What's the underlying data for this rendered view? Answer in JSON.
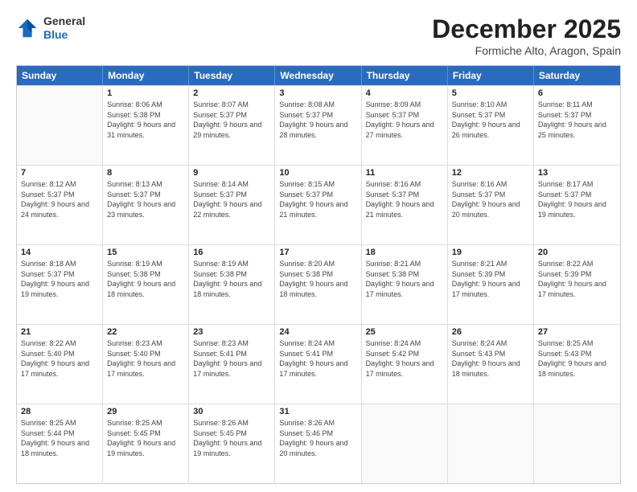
{
  "logo": {
    "general": "General",
    "blue": "Blue"
  },
  "header": {
    "title": "December 2025",
    "subtitle": "Formiche Alto, Aragon, Spain"
  },
  "days": [
    "Sunday",
    "Monday",
    "Tuesday",
    "Wednesday",
    "Thursday",
    "Friday",
    "Saturday"
  ],
  "weeks": [
    [
      {
        "day": "",
        "sunrise": "",
        "sunset": "",
        "daylight": ""
      },
      {
        "day": "1",
        "sunrise": "Sunrise: 8:06 AM",
        "sunset": "Sunset: 5:38 PM",
        "daylight": "Daylight: 9 hours and 31 minutes."
      },
      {
        "day": "2",
        "sunrise": "Sunrise: 8:07 AM",
        "sunset": "Sunset: 5:37 PM",
        "daylight": "Daylight: 9 hours and 29 minutes."
      },
      {
        "day": "3",
        "sunrise": "Sunrise: 8:08 AM",
        "sunset": "Sunset: 5:37 PM",
        "daylight": "Daylight: 9 hours and 28 minutes."
      },
      {
        "day": "4",
        "sunrise": "Sunrise: 8:09 AM",
        "sunset": "Sunset: 5:37 PM",
        "daylight": "Daylight: 9 hours and 27 minutes."
      },
      {
        "day": "5",
        "sunrise": "Sunrise: 8:10 AM",
        "sunset": "Sunset: 5:37 PM",
        "daylight": "Daylight: 9 hours and 26 minutes."
      },
      {
        "day": "6",
        "sunrise": "Sunrise: 8:11 AM",
        "sunset": "Sunset: 5:37 PM",
        "daylight": "Daylight: 9 hours and 25 minutes."
      }
    ],
    [
      {
        "day": "7",
        "sunrise": "Sunrise: 8:12 AM",
        "sunset": "Sunset: 5:37 PM",
        "daylight": "Daylight: 9 hours and 24 minutes."
      },
      {
        "day": "8",
        "sunrise": "Sunrise: 8:13 AM",
        "sunset": "Sunset: 5:37 PM",
        "daylight": "Daylight: 9 hours and 23 minutes."
      },
      {
        "day": "9",
        "sunrise": "Sunrise: 8:14 AM",
        "sunset": "Sunset: 5:37 PM",
        "daylight": "Daylight: 9 hours and 22 minutes."
      },
      {
        "day": "10",
        "sunrise": "Sunrise: 8:15 AM",
        "sunset": "Sunset: 5:37 PM",
        "daylight": "Daylight: 9 hours and 21 minutes."
      },
      {
        "day": "11",
        "sunrise": "Sunrise: 8:16 AM",
        "sunset": "Sunset: 5:37 PM",
        "daylight": "Daylight: 9 hours and 21 minutes."
      },
      {
        "day": "12",
        "sunrise": "Sunrise: 8:16 AM",
        "sunset": "Sunset: 5:37 PM",
        "daylight": "Daylight: 9 hours and 20 minutes."
      },
      {
        "day": "13",
        "sunrise": "Sunrise: 8:17 AM",
        "sunset": "Sunset: 5:37 PM",
        "daylight": "Daylight: 9 hours and 19 minutes."
      }
    ],
    [
      {
        "day": "14",
        "sunrise": "Sunrise: 8:18 AM",
        "sunset": "Sunset: 5:37 PM",
        "daylight": "Daylight: 9 hours and 19 minutes."
      },
      {
        "day": "15",
        "sunrise": "Sunrise: 8:19 AM",
        "sunset": "Sunset: 5:38 PM",
        "daylight": "Daylight: 9 hours and 18 minutes."
      },
      {
        "day": "16",
        "sunrise": "Sunrise: 8:19 AM",
        "sunset": "Sunset: 5:38 PM",
        "daylight": "Daylight: 9 hours and 18 minutes."
      },
      {
        "day": "17",
        "sunrise": "Sunrise: 8:20 AM",
        "sunset": "Sunset: 5:38 PM",
        "daylight": "Daylight: 9 hours and 18 minutes."
      },
      {
        "day": "18",
        "sunrise": "Sunrise: 8:21 AM",
        "sunset": "Sunset: 5:38 PM",
        "daylight": "Daylight: 9 hours and 17 minutes."
      },
      {
        "day": "19",
        "sunrise": "Sunrise: 8:21 AM",
        "sunset": "Sunset: 5:39 PM",
        "daylight": "Daylight: 9 hours and 17 minutes."
      },
      {
        "day": "20",
        "sunrise": "Sunrise: 8:22 AM",
        "sunset": "Sunset: 5:39 PM",
        "daylight": "Daylight: 9 hours and 17 minutes."
      }
    ],
    [
      {
        "day": "21",
        "sunrise": "Sunrise: 8:22 AM",
        "sunset": "Sunset: 5:40 PM",
        "daylight": "Daylight: 9 hours and 17 minutes."
      },
      {
        "day": "22",
        "sunrise": "Sunrise: 8:23 AM",
        "sunset": "Sunset: 5:40 PM",
        "daylight": "Daylight: 9 hours and 17 minutes."
      },
      {
        "day": "23",
        "sunrise": "Sunrise: 8:23 AM",
        "sunset": "Sunset: 5:41 PM",
        "daylight": "Daylight: 9 hours and 17 minutes."
      },
      {
        "day": "24",
        "sunrise": "Sunrise: 8:24 AM",
        "sunset": "Sunset: 5:41 PM",
        "daylight": "Daylight: 9 hours and 17 minutes."
      },
      {
        "day": "25",
        "sunrise": "Sunrise: 8:24 AM",
        "sunset": "Sunset: 5:42 PM",
        "daylight": "Daylight: 9 hours and 17 minutes."
      },
      {
        "day": "26",
        "sunrise": "Sunrise: 8:24 AM",
        "sunset": "Sunset: 5:43 PM",
        "daylight": "Daylight: 9 hours and 18 minutes."
      },
      {
        "day": "27",
        "sunrise": "Sunrise: 8:25 AM",
        "sunset": "Sunset: 5:43 PM",
        "daylight": "Daylight: 9 hours and 18 minutes."
      }
    ],
    [
      {
        "day": "28",
        "sunrise": "Sunrise: 8:25 AM",
        "sunset": "Sunset: 5:44 PM",
        "daylight": "Daylight: 9 hours and 18 minutes."
      },
      {
        "day": "29",
        "sunrise": "Sunrise: 8:25 AM",
        "sunset": "Sunset: 5:45 PM",
        "daylight": "Daylight: 9 hours and 19 minutes."
      },
      {
        "day": "30",
        "sunrise": "Sunrise: 8:26 AM",
        "sunset": "Sunset: 5:45 PM",
        "daylight": "Daylight: 9 hours and 19 minutes."
      },
      {
        "day": "31",
        "sunrise": "Sunrise: 8:26 AM",
        "sunset": "Sunset: 5:46 PM",
        "daylight": "Daylight: 9 hours and 20 minutes."
      },
      {
        "day": "",
        "sunrise": "",
        "sunset": "",
        "daylight": ""
      },
      {
        "day": "",
        "sunrise": "",
        "sunset": "",
        "daylight": ""
      },
      {
        "day": "",
        "sunrise": "",
        "sunset": "",
        "daylight": ""
      }
    ]
  ]
}
